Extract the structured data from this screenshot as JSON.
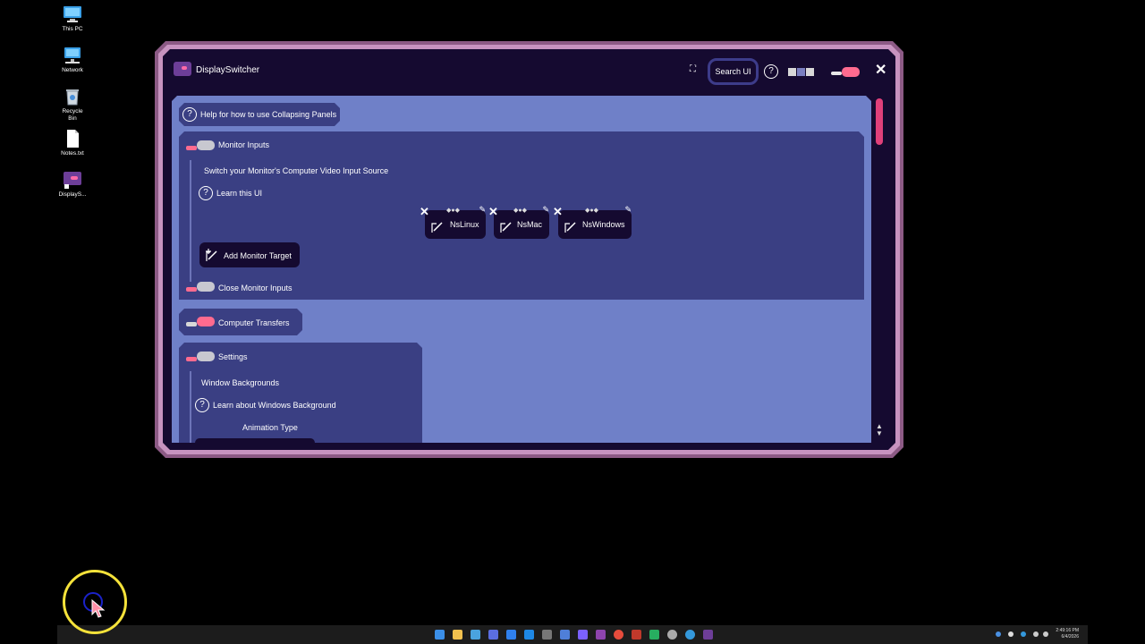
{
  "desktop": {
    "icons": [
      {
        "label": "This PC"
      },
      {
        "label": "Network"
      },
      {
        "label": "Recycle Bin"
      },
      {
        "label": "Notes.txt"
      },
      {
        "label": "DisplayS..."
      }
    ]
  },
  "window": {
    "title": "DisplaySwitcher",
    "search_label": "Search UI",
    "help_glyph": "?",
    "close_glyph": "✕",
    "fullscreen_glyph": "⛶",
    "help_collapsing": "Help for how to use Collapsing Panels",
    "monitor_inputs": {
      "header": "Monitor Inputs",
      "description": "Switch your Monitor's Computer Video Input Source",
      "learn": "Learn this UI",
      "targets": [
        {
          "name": "NsLinux"
        },
        {
          "name": "NsMac"
        },
        {
          "name": "NsWindows"
        }
      ],
      "add_target": "Add Monitor Target",
      "close_label": "Close Monitor Inputs"
    },
    "computer_transfers": {
      "header": "Computer Transfers"
    },
    "settings": {
      "header": "Settings",
      "window_backgrounds": "Window Backgrounds",
      "learn_backgrounds": "Learn about Windows Background",
      "animation_type": "Animation Type"
    }
  },
  "colors": {
    "accent_pink": "#ff6b8f",
    "panel_blue": "#3a3f83",
    "content_bg": "#6f80c8",
    "window_dark": "#150a30",
    "frame_mauve": "#c793c0"
  },
  "taskbar": {
    "time": "2:49:16 PM",
    "date": "6/4/2026"
  }
}
